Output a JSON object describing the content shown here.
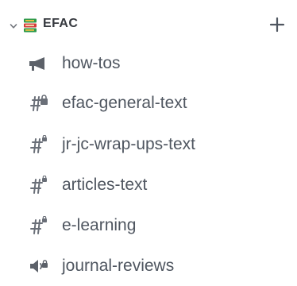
{
  "category": {
    "name": "EFAC",
    "icons": {
      "collapse": "chevron-down-icon",
      "server": "books-icon",
      "add": "plus-icon"
    }
  },
  "channels": [
    {
      "name": "how-tos",
      "icon": "announcement-megaphone-icon"
    },
    {
      "name": "efac-general-text",
      "icon": "hash-locked-icon"
    },
    {
      "name": "jr-jc-wrap-ups-text",
      "icon": "hash-locked-icon"
    },
    {
      "name": "articles-text",
      "icon": "hash-locked-icon"
    },
    {
      "name": "e-learning",
      "icon": "hash-locked-icon"
    },
    {
      "name": "journal-reviews",
      "icon": "voice-locked-icon"
    }
  ],
  "colors": {
    "text": "#4f5660",
    "icon": "#6a6f78",
    "category_text": "#36393f",
    "book_green": "#2d9a4b",
    "book_red": "#d33b3b",
    "book_yellow": "#f0c040"
  }
}
